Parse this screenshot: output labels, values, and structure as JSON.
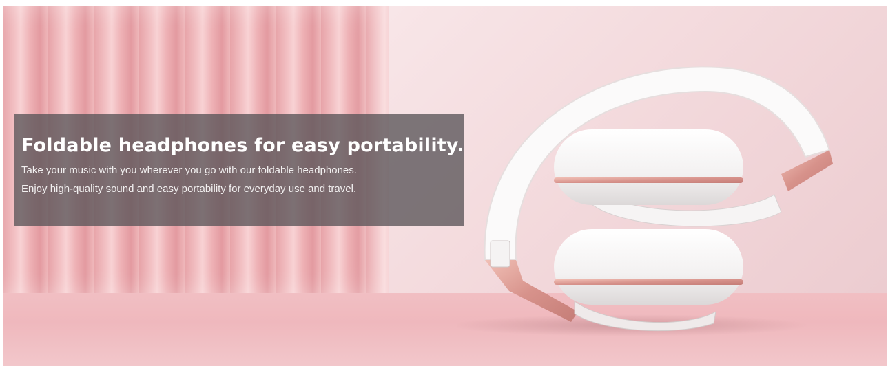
{
  "banner": {
    "headline": "Foldable headphones for easy portability.",
    "description_lines": [
      "Take your music with you wherever you go with our foldable headphones.",
      "Enjoy high-quality sound and easy portability for everyday use and travel."
    ],
    "product_image": "foldable-headphones-icon"
  },
  "colors": {
    "curtain": "#e9a8ad",
    "wall": "#f4dcdf",
    "floor": "#f0bcc0",
    "overlay": "#5a5558",
    "accent_rose_gold": "#d9918c",
    "headphone_white": "#f7f5f5"
  }
}
